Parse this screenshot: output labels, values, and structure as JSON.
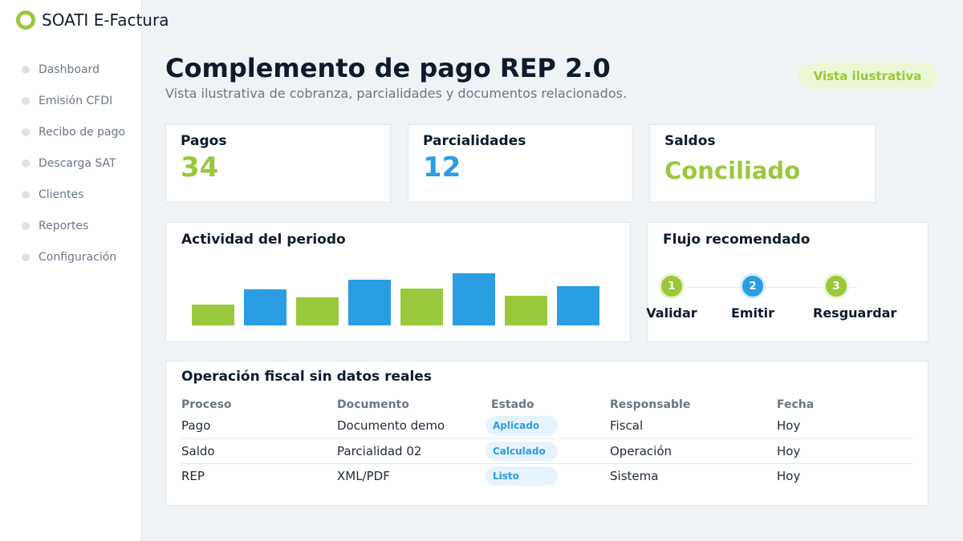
{
  "app": {
    "title": "SOATI E-Factura"
  },
  "sidebar": {
    "items": [
      {
        "label": "Dashboard"
      },
      {
        "label": "Emisión CFDI"
      },
      {
        "label": "Recibo de pago"
      },
      {
        "label": "Descarga SAT"
      },
      {
        "label": "Clientes"
      },
      {
        "label": "Reportes"
      },
      {
        "label": "Configuración"
      }
    ]
  },
  "header": {
    "title": "Complemento de pago REP 2.0",
    "subtitle": "Vista ilustrativa de cobranza, parcialidades y documentos relacionados.",
    "badge": "Vista ilustrativa"
  },
  "stats": [
    {
      "label": "Pagos",
      "value": "34",
      "color": "#9ac83c"
    },
    {
      "label": "Parcialidades",
      "value": "12",
      "color": "#2b9de3"
    },
    {
      "label": "Saldos",
      "value": "Conciliado",
      "color": "#9ac83c"
    }
  ],
  "activity": {
    "title": "Actividad del periodo",
    "chart_data": {
      "type": "bar",
      "values": [
        26,
        45,
        35,
        57,
        46,
        65,
        37,
        49
      ],
      "colors": [
        "#9ac83c",
        "#2b9de3",
        "#9ac83c",
        "#2b9de3",
        "#9ac83c",
        "#2b9de3",
        "#9ac83c",
        "#2b9de3"
      ]
    }
  },
  "flow": {
    "title": "Flujo recomendado",
    "steps": [
      {
        "number": "1",
        "label": "Validar",
        "color": "green"
      },
      {
        "number": "2",
        "label": "Emitir",
        "color": "blue"
      },
      {
        "number": "3",
        "label": "Resguardar",
        "color": "green"
      }
    ]
  },
  "table": {
    "title": "Operación fiscal sin datos reales",
    "columns": [
      "Proceso",
      "Documento",
      "Estado",
      "Responsable",
      "Fecha"
    ],
    "rows": [
      {
        "proceso": "Pago",
        "documento": "Documento demo",
        "estado": "Aplicado",
        "responsable": "Fiscal",
        "fecha": "Hoy"
      },
      {
        "proceso": "Saldo",
        "documento": "Parcialidad 02",
        "estado": "Calculado",
        "responsable": "Operación",
        "fecha": "Hoy"
      },
      {
        "proceso": "REP",
        "documento": "XML/PDF",
        "estado": "Listo",
        "responsable": "Sistema",
        "fecha": "Hoy"
      }
    ]
  },
  "colors": {
    "accent_green": "#9ac83c",
    "accent_blue": "#2b9de3"
  }
}
